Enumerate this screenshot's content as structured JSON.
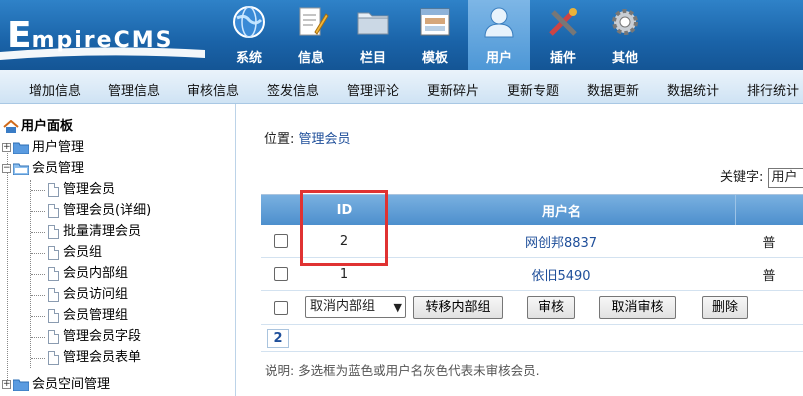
{
  "header": {
    "logo_initial": "E",
    "logo_rest": "mpireCMS",
    "nav": [
      {
        "label": "系统",
        "icon": "globe-icon",
        "active": false
      },
      {
        "label": "信息",
        "icon": "document-pen-icon",
        "active": false
      },
      {
        "label": "栏目",
        "icon": "folder-icon",
        "active": false
      },
      {
        "label": "模板",
        "icon": "window-template-icon",
        "active": false
      },
      {
        "label": "用户",
        "icon": "user-icon",
        "active": true
      },
      {
        "label": "插件",
        "icon": "tools-icon",
        "active": false
      },
      {
        "label": "其他",
        "icon": "gear-icon",
        "active": false
      }
    ]
  },
  "submenu": [
    "增加信息",
    "管理信息",
    "审核信息",
    "签发信息",
    "管理评论",
    "更新碎片",
    "更新专题",
    "数据更新",
    "数据统计",
    "排行统计"
  ],
  "tree": {
    "root": "用户面板",
    "user_mgmt": "用户管理",
    "member_mgmt": "会员管理",
    "member_items": [
      "管理会员",
      "管理会员(详细)",
      "批量清理会员",
      "会员组",
      "会员内部组",
      "会员访问组",
      "会员管理组",
      "管理会员字段",
      "管理会员表单"
    ],
    "space_mgmt": "会员空间管理"
  },
  "main": {
    "location_label": "位置:",
    "location_link": "管理会员",
    "keyword_label": "关键字:",
    "keyword_value": "用户"
  },
  "table": {
    "headers": {
      "id": "ID",
      "username": "用户名",
      "more": ""
    },
    "rows": [
      {
        "id": "2",
        "username": "网创邦8837",
        "more": "普"
      },
      {
        "id": "1",
        "username": "依旧5490",
        "more": "普"
      }
    ]
  },
  "actions": {
    "select_value": "取消内部组",
    "move_group": "转移内部组",
    "approve": "审核",
    "unapprove": "取消审核",
    "delete": "删除"
  },
  "pager": {
    "page": "2"
  },
  "note": "说明: 多选框为蓝色或用户名灰色代表未审核会员.",
  "colors": {
    "header_blue": "#1a63a8",
    "highlight_red": "#e03232",
    "link_blue": "#1f4f9a"
  }
}
